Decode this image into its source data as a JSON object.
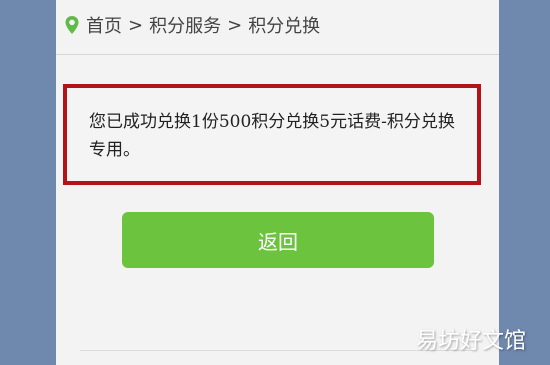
{
  "breadcrumb": {
    "icon": "location-pin-icon",
    "home": "首页",
    "separator": ">",
    "section": "积分服务",
    "current": "积分兑换"
  },
  "message": {
    "text": "您已成功兑换1份500积分兑换5元话费-积分兑换专用。"
  },
  "actions": {
    "back_label": "返回"
  },
  "watermark": {
    "text": "易坊好文馆"
  },
  "colors": {
    "background": "#6f88ad",
    "panel": "#f3f3f3",
    "highlight_border": "#b31218",
    "button": "#6cc33d",
    "pin": "#5dbb46"
  }
}
